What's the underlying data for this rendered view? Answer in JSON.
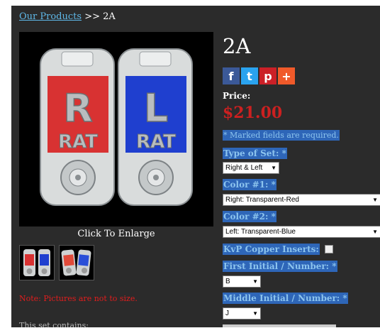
{
  "breadcrumb": {
    "link": "Our Products",
    "separator": ">>",
    "current": "2A"
  },
  "product": {
    "caption": "Click To Enlarge",
    "note": "Note: Pictures are not to size.",
    "contains": "This set contains:",
    "title": "2A",
    "price_label": "Price:",
    "price": "$21.00",
    "required_note": "* Marked fields are required."
  },
  "markers": [
    {
      "letter": "R",
      "word": "RAT",
      "color": "#d83232"
    },
    {
      "letter": "L",
      "word": "RAT",
      "color": "#1f3fcf"
    }
  ],
  "share": [
    {
      "icon": "facebook-icon",
      "glyph": "f",
      "color": "#3b5998"
    },
    {
      "icon": "twitter-icon",
      "glyph": "t",
      "color": "#2aa3ef"
    },
    {
      "icon": "pinterest-icon",
      "glyph": "p",
      "color": "#cb2027"
    },
    {
      "icon": "addthis-icon",
      "glyph": "+",
      "color": "#f05a2a"
    }
  ],
  "form": {
    "type_label": "Type of Set: *",
    "type_value": "Right & Left",
    "color1_label": "Color #1: *",
    "color1_value": "Right: Transparent-Red",
    "color2_label": "Color #2: *",
    "color2_value": "Left: Transparent-Blue",
    "kvp_label": "KvP Copper Inserts:",
    "first_label": "First Initial / Number: *",
    "first_value": "B",
    "middle_label": "Middle Initial / Number: *",
    "middle_value": "J"
  }
}
